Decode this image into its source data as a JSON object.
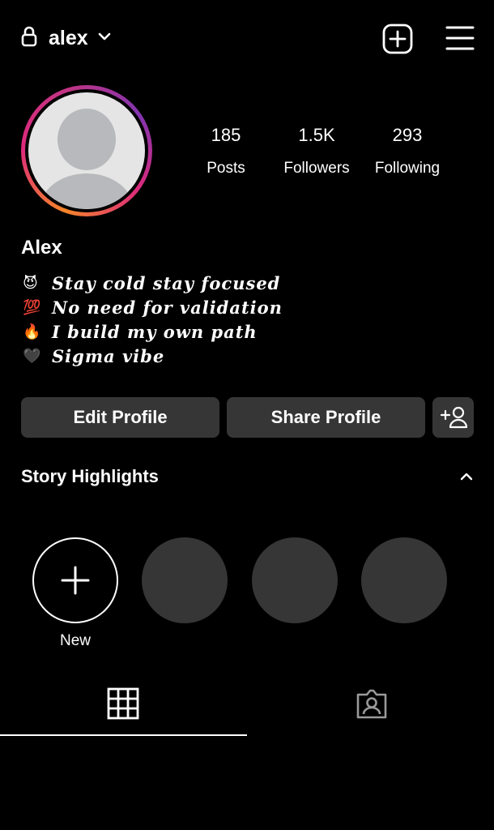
{
  "header": {
    "username": "alex",
    "icons": [
      "lock-icon",
      "chevron-down-icon",
      "add-post-icon",
      "hamburger-menu-icon"
    ]
  },
  "profile": {
    "display_name": "Alex",
    "stats": {
      "posts": {
        "value": "185",
        "label": "Posts"
      },
      "followers": {
        "value": "1.5K",
        "label": "Followers"
      },
      "following": {
        "value": "293",
        "label": "Following"
      }
    },
    "bio": [
      {
        "emoji": "😈",
        "text": "Stay cold stay focused"
      },
      {
        "emoji": "💯",
        "text": "No need for validation"
      },
      {
        "emoji": "🔥",
        "text": "I build my own path"
      },
      {
        "emoji": "🖤",
        "text": "Sigma vibe"
      }
    ]
  },
  "actions": {
    "edit_label": "Edit Profile",
    "share_label": "Share Profile"
  },
  "highlights": {
    "title": "Story Highlights",
    "new_label": "New"
  },
  "colors": {
    "background": "#000000",
    "button": "#363636",
    "avatar_ring_start": "#f58529",
    "avatar_ring_end": "#c13584"
  }
}
